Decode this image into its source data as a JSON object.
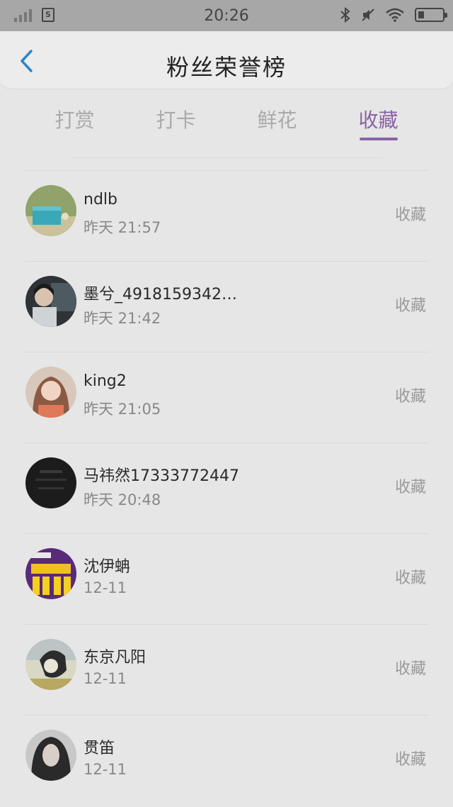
{
  "status_bar": {
    "time": "20:26",
    "icons": [
      "signal-icon",
      "sim-icon",
      "bluetooth-icon",
      "mute-icon",
      "wifi-icon",
      "battery-icon"
    ]
  },
  "nav": {
    "title": "粉丝荣誉榜",
    "back_icon": "chevron-left-icon"
  },
  "tabs": [
    {
      "label": "打赏",
      "active": false
    },
    {
      "label": "打卡",
      "active": false
    },
    {
      "label": "鲜花",
      "active": false
    },
    {
      "label": "收藏",
      "active": true
    }
  ],
  "colors": {
    "accent": "#8a63a6",
    "back_arrow": "#2d86c8"
  },
  "fans": [
    {
      "name": "ndlb",
      "time": "昨天 21:57",
      "action": "收藏"
    },
    {
      "name": "墨兮_4918159342…",
      "time": "昨天 21:42",
      "action": "收藏"
    },
    {
      "name": "king2",
      "time": "昨天 21:05",
      "action": "收藏"
    },
    {
      "name": "马祎然17333772447",
      "time": "昨天 20:48",
      "action": "收藏"
    },
    {
      "name": "沈伊蚺",
      "time": "12-11",
      "action": "收藏"
    },
    {
      "name": "东京凡阳",
      "time": "12-11",
      "action": "收藏"
    },
    {
      "name": "贯笛",
      "time": "12-11",
      "action": "收藏"
    }
  ]
}
